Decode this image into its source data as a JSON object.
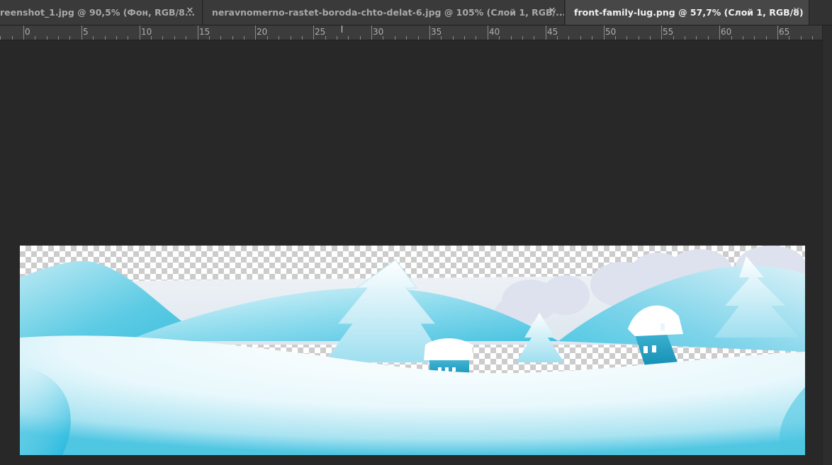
{
  "tabs": [
    {
      "label": "reenshot_1.jpg @ 90,5% (Фон, RGB/8...",
      "active": false
    },
    {
      "label": "neravnomerno-rastet-boroda-chto-delat-6.jpg @ 105% (Слой 1, RGB/...",
      "active": false
    },
    {
      "label": "front-family-lug.png @ 57,7% (Слой 1, RGB/8)",
      "active": true
    }
  ],
  "ruler": {
    "labels": [
      "0",
      "5",
      "10",
      "15",
      "20",
      "25",
      "30",
      "35",
      "40",
      "45",
      "50",
      "55",
      "60",
      "65"
    ]
  },
  "canvas": {
    "image_name": "front-family-lug.png",
    "colors": {
      "workspace": "#282828",
      "snow_light": "#f2fbfd",
      "hill_cyan": "#4fc8e3",
      "house_teal": "#1d9fc0"
    }
  }
}
